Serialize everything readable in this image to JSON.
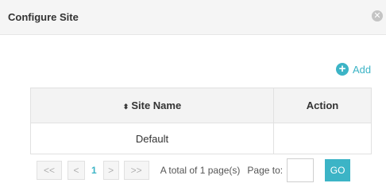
{
  "dialog": {
    "title": "Configure Site",
    "close_glyph": "✕"
  },
  "toolbar": {
    "add_label": "Add",
    "add_icon": "plus-circle-icon"
  },
  "table": {
    "columns": [
      "Site Name",
      "Action"
    ],
    "sort_icon": "⬍",
    "rows": [
      {
        "site_name": "Default",
        "action": ""
      }
    ]
  },
  "pagination": {
    "first": "<<",
    "prev": "<",
    "current_page": "1",
    "next": ">",
    "last": ">>",
    "total_text": "A total of 1 page(s)",
    "page_to_label": "Page to:",
    "page_input_value": "",
    "go_label": "GO"
  },
  "colors": {
    "accent": "#3cb4c6",
    "header_bg": "#f5f5f5",
    "table_header_bg": "#f3f3f3",
    "border": "#e1e1e1"
  }
}
